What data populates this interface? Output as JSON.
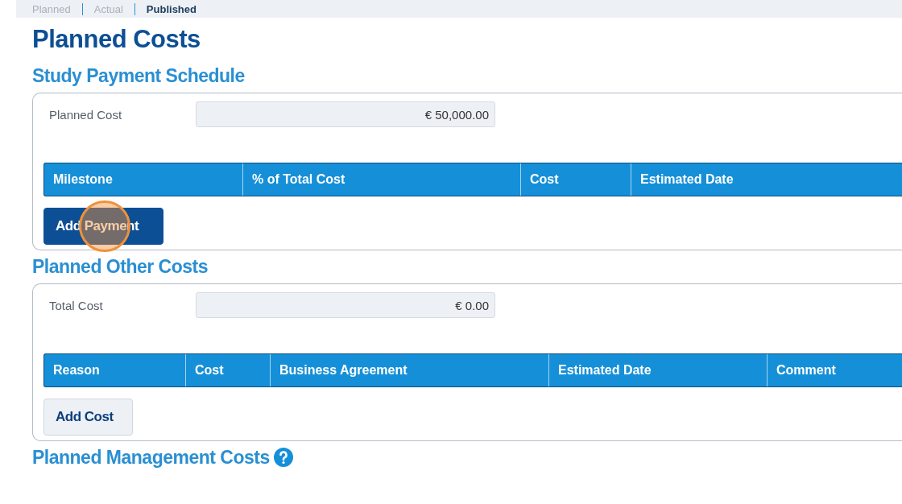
{
  "tabs": [
    {
      "label": "Planned",
      "selected": false
    },
    {
      "label": "Actual",
      "selected": false
    },
    {
      "label": "Published",
      "selected": true
    }
  ],
  "page_title": "Planned Costs",
  "sections": [
    {
      "title": "Study Payment Schedule",
      "help": false,
      "field": {
        "label": "Planned Cost",
        "value": "€ 50,000.00"
      },
      "columns": [
        "Milestone",
        "% of Total Cost",
        "Cost",
        "Estimated Date"
      ],
      "button": {
        "label": "Add Payment",
        "kind": "primary",
        "clicked": true
      }
    },
    {
      "title": "Planned Other Costs",
      "help": false,
      "field": {
        "label": "Total Cost",
        "value": "€ 0.00"
      },
      "columns": [
        "Reason",
        "Cost",
        "Business Agreement",
        "Estimated Date",
        "Comment"
      ],
      "button": {
        "label": "Add Cost",
        "kind": "secondary",
        "clicked": false
      }
    },
    {
      "title": "Planned Management Costs",
      "help": true
    }
  ]
}
